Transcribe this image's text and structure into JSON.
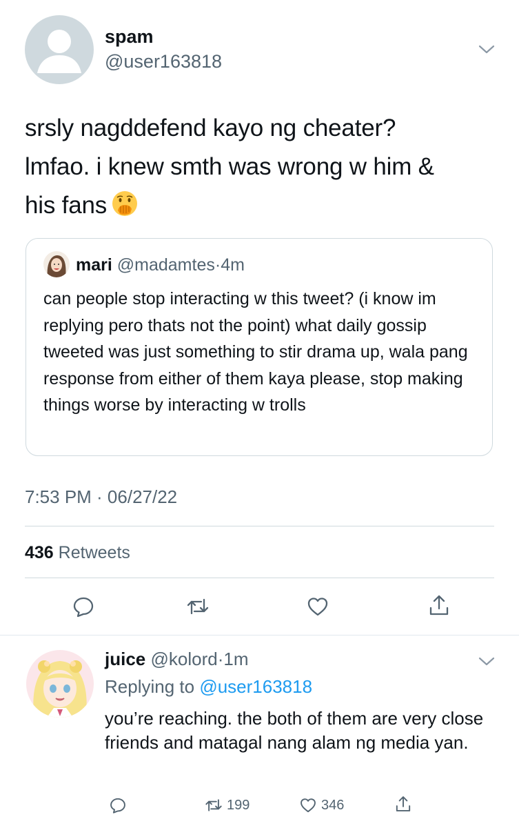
{
  "tweet": {
    "author_name": "spam",
    "author_handle": "@user163818",
    "text_line1": "srsly nagddefend kayo ng cheater?",
    "text_line2": "lmfao. i knew smth was wrong w him &",
    "text_line3": "his fans",
    "emoji_icon": "face-with-hand-over-mouth-icon",
    "timestamp": "7:53 PM · 06/27/22",
    "retweet_count": "436",
    "retweet_label": "Retweets"
  },
  "quote": {
    "name": "mari",
    "handle": "@madamtes",
    "sep": "·",
    "age": "4m",
    "text": "can people stop interacting w this tweet? (i know im replying pero thats not the point) what daily gossip tweeted was just something to stir drama up, wala pang response from either of them kaya please, stop making things worse by interacting w trolls"
  },
  "reply": {
    "name": "juice",
    "handle": "@kolord",
    "sep": "·",
    "age": "1m",
    "replying_prefix": "Replying to",
    "replying_to": "@user163818",
    "text": "you’re reaching. the both of them are very close friends and matagal nang alam ng media yan.",
    "retweets": "199",
    "likes": "346"
  },
  "colors": {
    "accent": "#1d9bf0",
    "secondary_text": "#536471",
    "border": "#cfd9de"
  }
}
